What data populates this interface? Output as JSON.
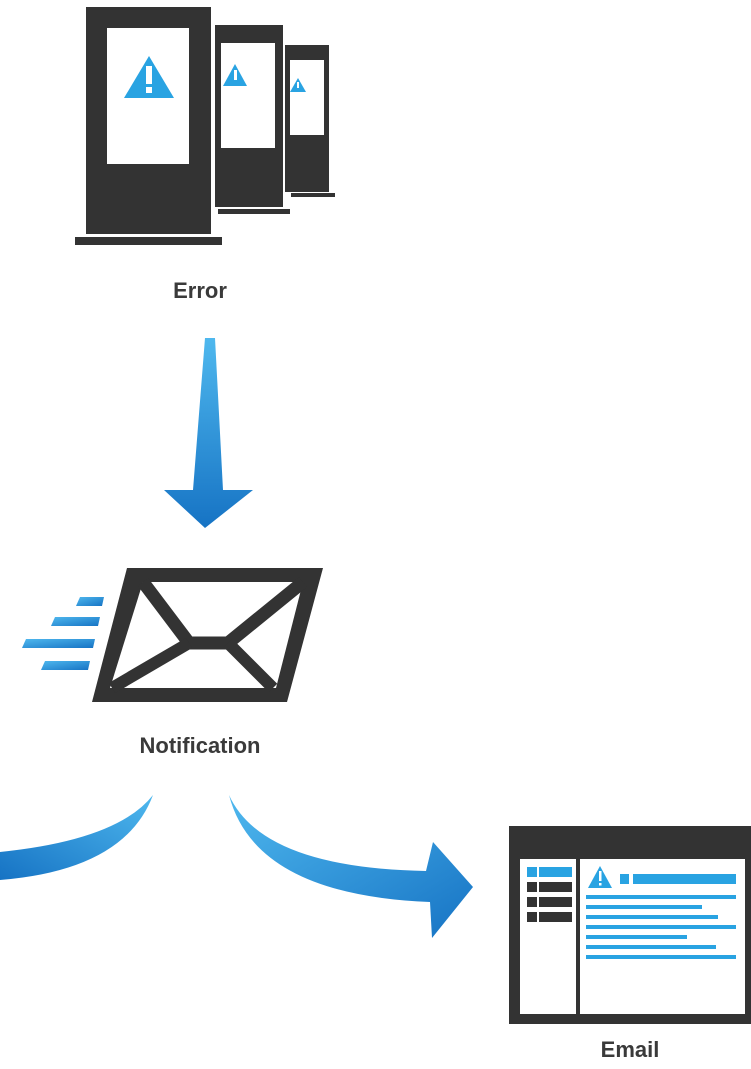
{
  "labels": {
    "error": "Error",
    "notification": "Notification",
    "email": "Email"
  },
  "icons": {
    "devices": "kiosk-displays-warning-icon",
    "arrow_down": "arrow-down-icon",
    "envelope": "envelope-icon",
    "speed_lines": "motion-lines-icon",
    "branch_left": "curved-arrow-left-icon",
    "branch_right": "curved-arrow-right-icon",
    "email_window": "email-client-window-icon",
    "warning": "warning-triangle-icon"
  },
  "colors": {
    "dark": "#333333",
    "accent_light": "#3aa8e6",
    "accent_dark": "#1673c4",
    "text": "#3a3a3a",
    "background": "#ffffff"
  }
}
